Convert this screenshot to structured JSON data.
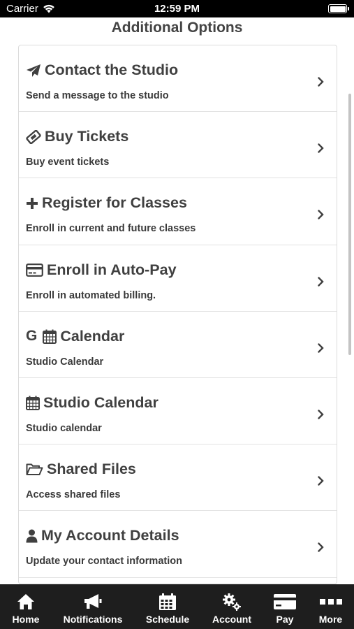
{
  "status_bar": {
    "carrier": "Carrier",
    "time": "12:59 PM"
  },
  "page": {
    "title": "Additional Options"
  },
  "items": [
    {
      "icon": "paper-plane-icon",
      "title": "Contact the Studio",
      "subtitle": "Send a message to the studio"
    },
    {
      "icon": "ticket-icon",
      "title": "Buy Tickets",
      "subtitle": "Buy event tickets"
    },
    {
      "icon": "plus-icon",
      "title": "Register for Classes",
      "subtitle": "Enroll in current and future classes"
    },
    {
      "icon": "credit-card-icon",
      "title": "Enroll in Auto-Pay",
      "subtitle": "Enroll in automated billing."
    },
    {
      "icon": "google-calendar-icon",
      "icon_letter": "G",
      "title": "Calendar",
      "subtitle": "Studio Calendar"
    },
    {
      "icon": "calendar-icon",
      "title": "Studio Calendar",
      "subtitle": "Studio calendar"
    },
    {
      "icon": "folder-open-icon",
      "title": "Shared Files",
      "subtitle": "Access shared files"
    },
    {
      "icon": "user-icon",
      "title": "My Account Details",
      "subtitle": "Update your contact information"
    }
  ],
  "tab_bar": [
    {
      "icon": "home-icon",
      "label": "Home"
    },
    {
      "icon": "megaphone-icon",
      "label": "Notifications"
    },
    {
      "icon": "calendar-icon",
      "label": "Schedule"
    },
    {
      "icon": "gears-icon",
      "label": "Account"
    },
    {
      "icon": "credit-card-icon",
      "label": "Pay"
    },
    {
      "icon": "more-icon",
      "label": "More"
    }
  ]
}
